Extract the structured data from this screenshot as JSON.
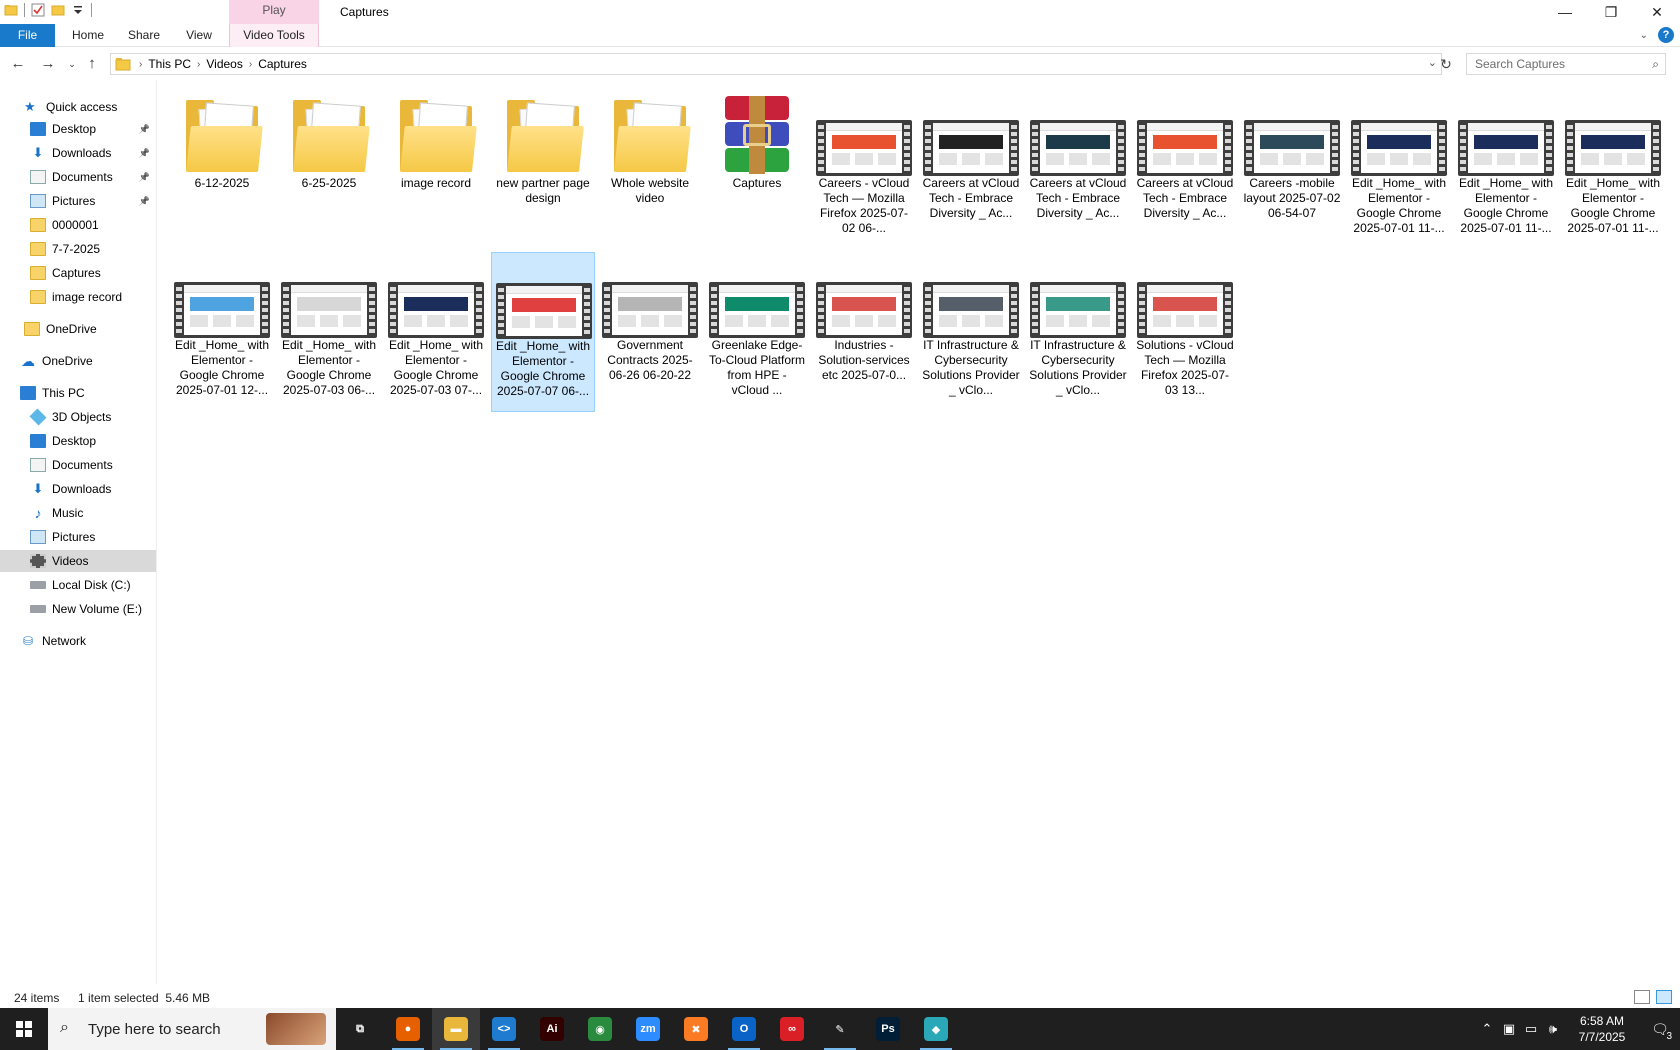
{
  "window": {
    "title": "Captures",
    "contextual_tab": "Play",
    "controls": {
      "minimize": "—",
      "maximize": "❐",
      "close": "✕"
    }
  },
  "ribbon": {
    "tabs": [
      "File",
      "Home",
      "Share",
      "View",
      "Video Tools"
    ]
  },
  "address": {
    "crumbs": [
      "This PC",
      "Videos",
      "Captures"
    ],
    "search_placeholder": "Search Captures"
  },
  "sidebar": {
    "items": [
      {
        "label": "Quick access",
        "icon": "star-icon",
        "pinned": false
      },
      {
        "label": "Desktop",
        "icon": "desktop-icon",
        "pinned": true
      },
      {
        "label": "Downloads",
        "icon": "download-icon",
        "pinned": true
      },
      {
        "label": "Documents",
        "icon": "documents-icon",
        "pinned": true
      },
      {
        "label": "Pictures",
        "icon": "pictures-icon",
        "pinned": true
      },
      {
        "label": "0000001",
        "icon": "folder-icon",
        "pinned": false
      },
      {
        "label": "7-7-2025",
        "icon": "folder-icon",
        "pinned": false
      },
      {
        "label": "Captures",
        "icon": "folder-icon",
        "pinned": false
      },
      {
        "label": "image record",
        "icon": "folder-icon",
        "pinned": false
      },
      {
        "label": "OneDrive",
        "icon": "folder-icon",
        "pinned": false
      },
      {
        "label": "OneDrive",
        "icon": "cloud-icon",
        "pinned": false
      },
      {
        "label": "This PC",
        "icon": "computer-icon",
        "pinned": false
      },
      {
        "label": "3D Objects",
        "icon": "cube-icon",
        "pinned": false
      },
      {
        "label": "Desktop",
        "icon": "desktop-icon",
        "pinned": false
      },
      {
        "label": "Documents",
        "icon": "documents-icon",
        "pinned": false
      },
      {
        "label": "Downloads",
        "icon": "download-icon",
        "pinned": false
      },
      {
        "label": "Music",
        "icon": "music-icon",
        "pinned": false
      },
      {
        "label": "Pictures",
        "icon": "pictures-icon",
        "pinned": false
      },
      {
        "label": "Videos",
        "icon": "videos-icon",
        "pinned": false
      },
      {
        "label": "Local Disk (C:)",
        "icon": "drive-icon",
        "pinned": false
      },
      {
        "label": "New Volume (E:)",
        "icon": "drive-icon",
        "pinned": false
      },
      {
        "label": "Network",
        "icon": "network-icon",
        "pinned": false
      }
    ],
    "selected": "Videos"
  },
  "files": [
    {
      "label": "6-12-2025",
      "kind": "folder"
    },
    {
      "label": "6-25-2025",
      "kind": "folder"
    },
    {
      "label": "image record",
      "kind": "folder"
    },
    {
      "label": "new partner page design",
      "kind": "folder"
    },
    {
      "label": "Whole website video",
      "kind": "folder"
    },
    {
      "label": "Captures",
      "kind": "archive"
    },
    {
      "label": "Careers - vCloud Tech — Mozilla Firefox 2025-07-02 06-...",
      "kind": "video",
      "accent": "#e8522f"
    },
    {
      "label": "Careers at vCloud Tech - Embrace Diversity _ Ac...",
      "kind": "video",
      "accent": "#222222"
    },
    {
      "label": "Careers at vCloud Tech - Embrace Diversity _ Ac...",
      "kind": "video",
      "accent": "#1d3a4a"
    },
    {
      "label": "Careers at vCloud Tech - Embrace Diversity _ Ac...",
      "kind": "video",
      "accent": "#e8522f"
    },
    {
      "label": "Careers -mobile layout 2025-07-02 06-54-07",
      "kind": "video",
      "accent": "#2c4a5a"
    },
    {
      "label": "Edit _Home_ with Elementor - Google Chrome 2025-07-01 11-...",
      "kind": "video",
      "accent": "#1b2d5a"
    },
    {
      "label": "Edit _Home_ with Elementor - Google Chrome 2025-07-01 11-...",
      "kind": "video",
      "accent": "#1b2d5a"
    },
    {
      "label": "Edit _Home_ with Elementor - Google Chrome 2025-07-01 11-...",
      "kind": "video",
      "accent": "#1b2d5a"
    },
    {
      "label": "Edit _Home_ with Elementor - Google Chrome 2025-07-01 12-...",
      "kind": "video",
      "accent": "#4fa3e0"
    },
    {
      "label": "Edit _Home_ with Elementor - Google Chrome 2025-07-03 06-...",
      "kind": "video",
      "accent": "#d7d7d7"
    },
    {
      "label": "Edit _Home_ with Elementor - Google Chrome 2025-07-03 07-...",
      "kind": "video",
      "accent": "#1b2d5a"
    },
    {
      "label": "Edit _Home_ with Elementor - Google Chrome 2025-07-07 06-...",
      "kind": "video",
      "accent": "#e04040",
      "selected": true
    },
    {
      "label": "Government Contracts 2025-06-26 06-20-22",
      "kind": "video",
      "accent": "#b5b5b5"
    },
    {
      "label": "Greenlake Edge-To-Cloud Platform from HPE - vCloud ...",
      "kind": "video",
      "accent": "#0f8a6a"
    },
    {
      "label": "Industries -Solution-services etc 2025-07-0...",
      "kind": "video",
      "accent": "#d9534f"
    },
    {
      "label": "IT Infrastructure & Cybersecurity Solutions Provider _ vClo...",
      "kind": "video",
      "accent": "#555f6a"
    },
    {
      "label": "IT Infrastructure & Cybersecurity Solutions Provider _ vClo...",
      "kind": "video",
      "accent": "#3a9a8a"
    },
    {
      "label": "Solutions - vCloud Tech — Mozilla Firefox 2025-07-03 13...",
      "kind": "video",
      "accent": "#d9534f"
    }
  ],
  "status": {
    "item_count": "24 items",
    "selection": "1 item selected  5.46 MB"
  },
  "taskbar": {
    "search_placeholder": "Type here to search",
    "apps": [
      {
        "name": "task-view",
        "glyph": "⧉",
        "color": "#1f1f1f"
      },
      {
        "name": "firefox",
        "glyph": "●",
        "color": "#e66000"
      },
      {
        "name": "file-explorer",
        "glyph": "▬",
        "color": "#e9b83a"
      },
      {
        "name": "vscode",
        "glyph": "<>",
        "color": "#1e7bd0"
      },
      {
        "name": "illustrator",
        "glyph": "Ai",
        "color": "#330000"
      },
      {
        "name": "chrome",
        "glyph": "◉",
        "color": "#2a8a3e"
      },
      {
        "name": "zoom",
        "glyph": "zm",
        "color": "#2d8cff"
      },
      {
        "name": "xampp",
        "glyph": "✖",
        "color": "#fb7a24"
      },
      {
        "name": "outlook",
        "glyph": "O",
        "color": "#0a64c8"
      },
      {
        "name": "creative-cloud",
        "glyph": "∞",
        "color": "#da1f26"
      },
      {
        "name": "pen-tool",
        "glyph": "✎",
        "color": "#1f1f1f"
      },
      {
        "name": "photoshop",
        "glyph": "Ps",
        "color": "#001e36"
      },
      {
        "name": "app-diamond",
        "glyph": "◆",
        "color": "#2aa8b8"
      }
    ],
    "clock_time": "6:58 AM",
    "clock_date": "7/7/2025",
    "notification_count": "3"
  }
}
